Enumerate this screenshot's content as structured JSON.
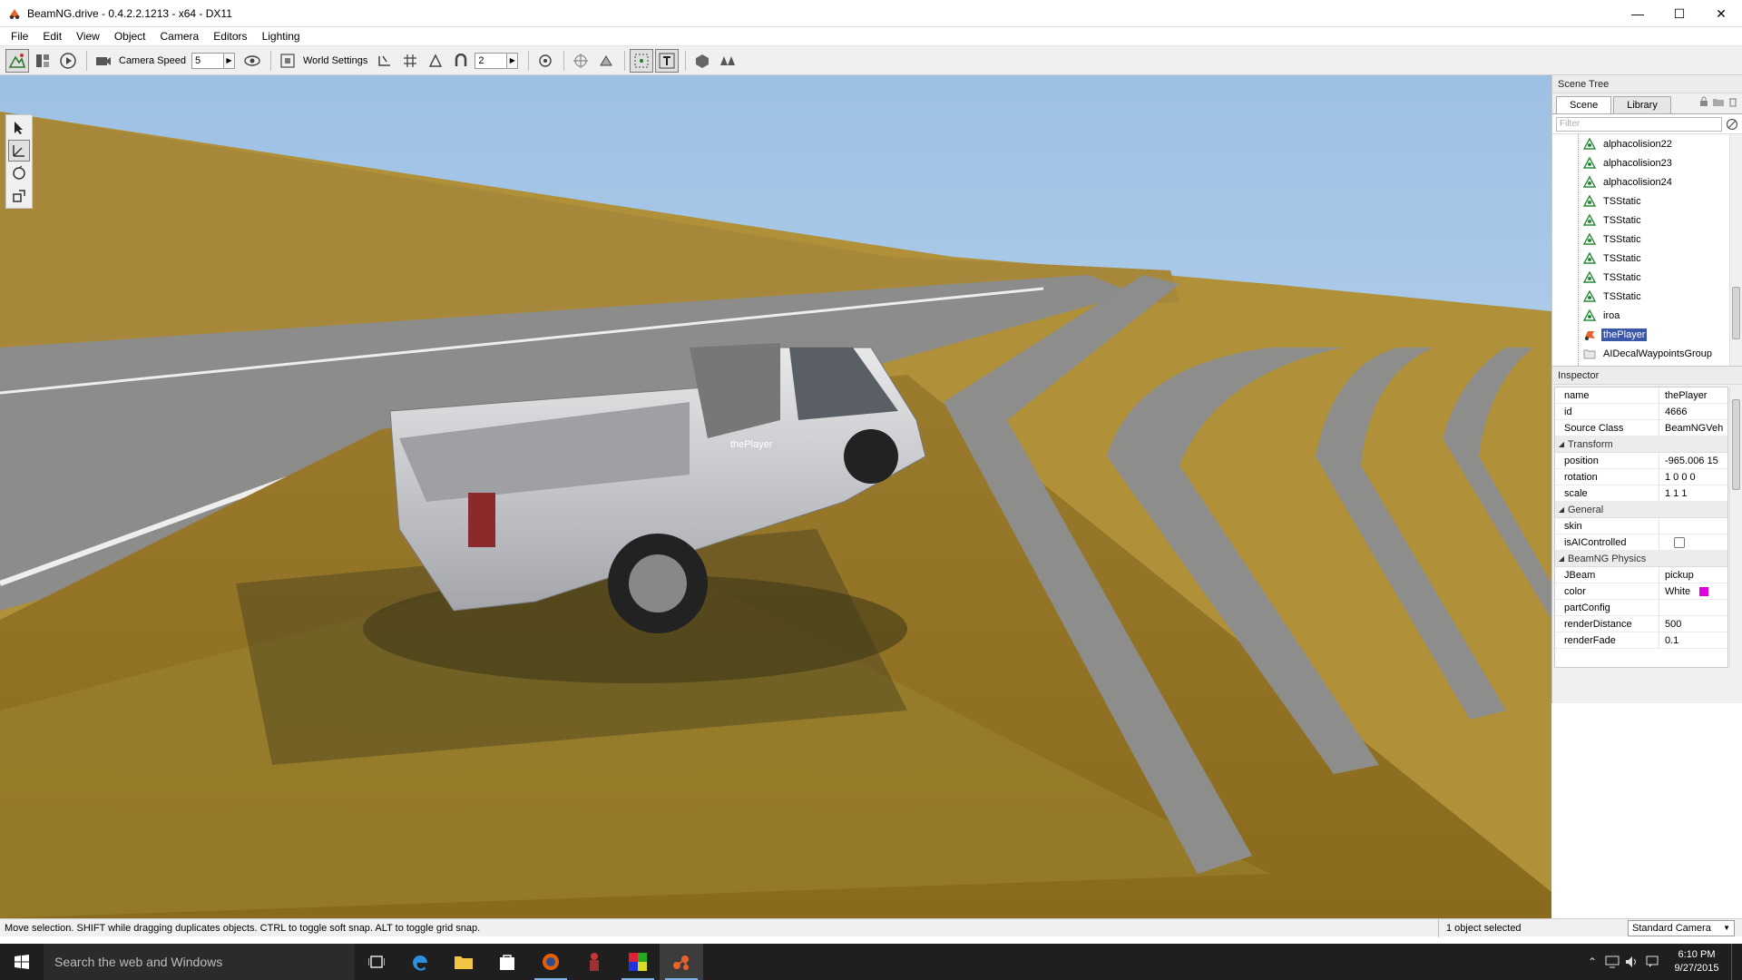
{
  "window": {
    "title": "BeamNG.drive - 0.4.2.2.1213 - x64 - DX11",
    "controls": {
      "minimize": "—",
      "maximize": "☐",
      "close": "✕"
    }
  },
  "menu": [
    "File",
    "Edit",
    "View",
    "Object",
    "Camera",
    "Editors",
    "Lighting"
  ],
  "toolbar": {
    "camera_speed_label": "Camera Speed",
    "camera_speed_value": "5",
    "world_settings_label": "World Settings",
    "grid_value": "2"
  },
  "scene_tree": {
    "title": "Scene Tree",
    "tabs": [
      "Scene",
      "Library"
    ],
    "filter_placeholder": "Filter",
    "items": [
      {
        "label": "alphacolision22",
        "icon": "shape-icon",
        "selected": false
      },
      {
        "label": "alphacolision23",
        "icon": "shape-icon",
        "selected": false
      },
      {
        "label": "alphacolision24",
        "icon": "shape-icon",
        "selected": false
      },
      {
        "label": "TSStatic",
        "icon": "shape-icon",
        "selected": false
      },
      {
        "label": "TSStatic",
        "icon": "shape-icon",
        "selected": false
      },
      {
        "label": "TSStatic",
        "icon": "shape-icon",
        "selected": false
      },
      {
        "label": "TSStatic",
        "icon": "shape-icon",
        "selected": false
      },
      {
        "label": "TSStatic",
        "icon": "shape-icon",
        "selected": false
      },
      {
        "label": "TSStatic",
        "icon": "shape-icon",
        "selected": false
      },
      {
        "label": "iroa",
        "icon": "shape-icon",
        "selected": false
      },
      {
        "label": "thePlayer",
        "icon": "vehicle-icon",
        "selected": true
      },
      {
        "label": "AIDecalWaypointsGroup",
        "icon": "folder-icon",
        "selected": false
      }
    ]
  },
  "inspector": {
    "title": "Inspector",
    "fields": {
      "name": {
        "key": "name",
        "value": "thePlayer"
      },
      "id": {
        "key": "id",
        "value": "4666"
      },
      "source_class": {
        "key": "Source Class",
        "value": "BeamNGVeh"
      }
    },
    "groups": {
      "transform": {
        "label": "Transform",
        "rows": [
          {
            "key": "position",
            "value": "-965.006 15"
          },
          {
            "key": "rotation",
            "value": "1 0 0 0"
          },
          {
            "key": "scale",
            "value": "1 1 1"
          }
        ]
      },
      "general": {
        "label": "General",
        "rows": [
          {
            "key": "skin",
            "value": ""
          },
          {
            "key": "isAIControlled",
            "value": ""
          }
        ]
      },
      "physics": {
        "label": "BeamNG Physics",
        "rows": [
          {
            "key": "JBeam",
            "value": "pickup"
          },
          {
            "key": "color",
            "value": "White"
          },
          {
            "key": "partConfig",
            "value": ""
          },
          {
            "key": "renderDistance",
            "value": "500"
          },
          {
            "key": "renderFade",
            "value": "0.1"
          }
        ]
      }
    },
    "color_swatch": "#e000e0"
  },
  "viewport": {
    "vehicle_label": "thePlayer"
  },
  "status": {
    "hint": "Move selection.  SHIFT while dragging duplicates objects.  CTRL to toggle soft snap.  ALT to toggle grid snap.",
    "selection": "1 object selected",
    "camera": "Standard Camera"
  },
  "taskbar": {
    "search_placeholder": "Search the web and Windows",
    "time": "6:10 PM",
    "date": "9/27/2015"
  },
  "colors": {
    "selection": "#3a57a8",
    "accent": "#e8622c",
    "taskbar": "#1f1f1f"
  }
}
